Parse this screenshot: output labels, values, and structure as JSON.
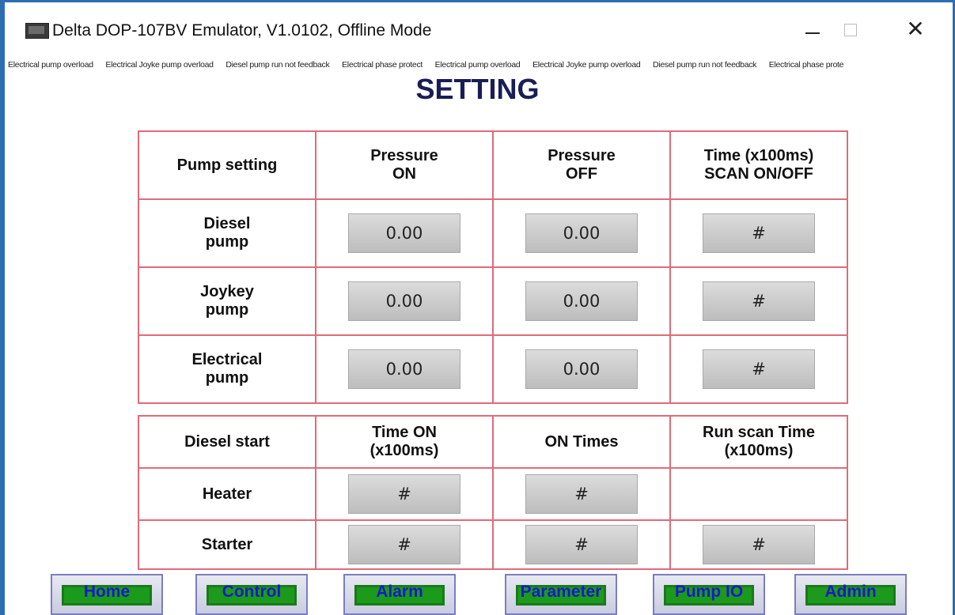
{
  "window": {
    "title": "Delta DOP-107BV Emulator, V1.0102, Offline Mode",
    "controls": {
      "minimize": "—",
      "maximize": "☐",
      "close": "✕"
    },
    "icon": "app-window-icon"
  },
  "alarm_ticker": [
    "Electrical pump overload",
    "Electrical Joyke pump overload",
    "Diesel pump run not feedback",
    "Electrical phase protect",
    "Electrical pump overload",
    "Electrical Joyke pump overload",
    "Diesel pump run not feedback",
    "Electrical phase prote"
  ],
  "page": {
    "title": "SETTING"
  },
  "pump_table": {
    "headers": [
      "Pump setting",
      "Pressure\nON",
      "Pressure\nOFF",
      "Time (x100ms)\nSCAN ON/OFF"
    ],
    "rows": [
      {
        "label": "Diesel\npump",
        "pressure_on": "0.00",
        "pressure_off": "0.00",
        "time": "#"
      },
      {
        "label": "Joykey\npump",
        "pressure_on": "0.00",
        "pressure_off": "0.00",
        "time": "#"
      },
      {
        "label": "Electrical\npump",
        "pressure_on": "0.00",
        "pressure_off": "0.00",
        "time": "#"
      }
    ]
  },
  "diesel_table": {
    "headers": [
      "Diesel start",
      "Time ON\n(x100ms)",
      "ON Times",
      "Run scan Time\n(x100ms)"
    ],
    "rows": [
      {
        "label": "Heater",
        "time_on": "#",
        "on_times": "#",
        "run_scan": ""
      },
      {
        "label": "Starter",
        "time_on": "#",
        "on_times": "#",
        "run_scan": "#"
      }
    ]
  },
  "nav": [
    "Home",
    "Control",
    "Alarm",
    "Parameter",
    "Pump IO",
    "Admin"
  ]
}
